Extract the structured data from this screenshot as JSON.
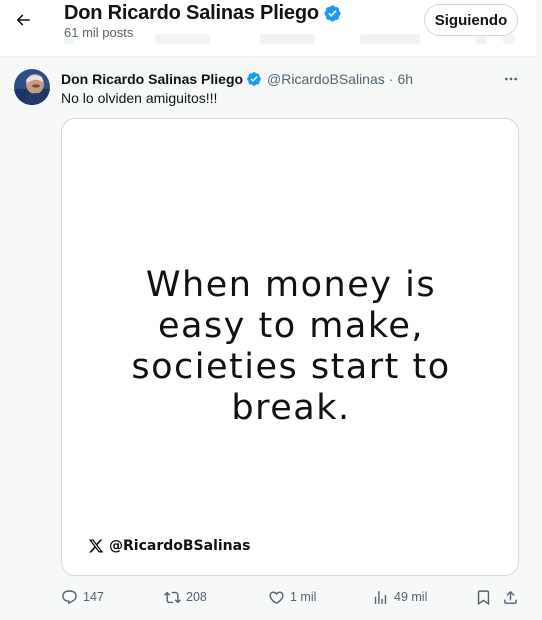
{
  "header": {
    "display_name": "Don Ricardo Salinas Pliego",
    "posts_count": "61 mil posts",
    "follow_button_label": "Siguiendo",
    "back_icon": "arrow-left-icon",
    "verified_icon": "verified-badge-icon"
  },
  "post": {
    "author_name": "Don Ricardo Salinas Pliego",
    "author_handle": "@RicardoBSalinas",
    "separator": "·",
    "time_ago": "6h",
    "text": "No lo olviden amiguitos!!!",
    "more_icon": "more-horizontal-icon"
  },
  "media": {
    "quote_lines": [
      "When money is",
      "easy to make,",
      "societies start to",
      "break."
    ],
    "footer_handle": "@RicardoBSalinas",
    "footer_icon": "x-logo-icon"
  },
  "actions": {
    "replies": "147",
    "reposts": "208",
    "likes": "1 mil",
    "views": "49 mil",
    "icons": [
      "reply-icon",
      "repost-icon",
      "like-icon",
      "views-icon",
      "bookmark-icon",
      "share-icon"
    ]
  },
  "colors": {
    "verified_blue": "#1d9bf0",
    "text_primary": "#0f1419",
    "text_secondary": "#536471",
    "border": "#cfd9de"
  }
}
